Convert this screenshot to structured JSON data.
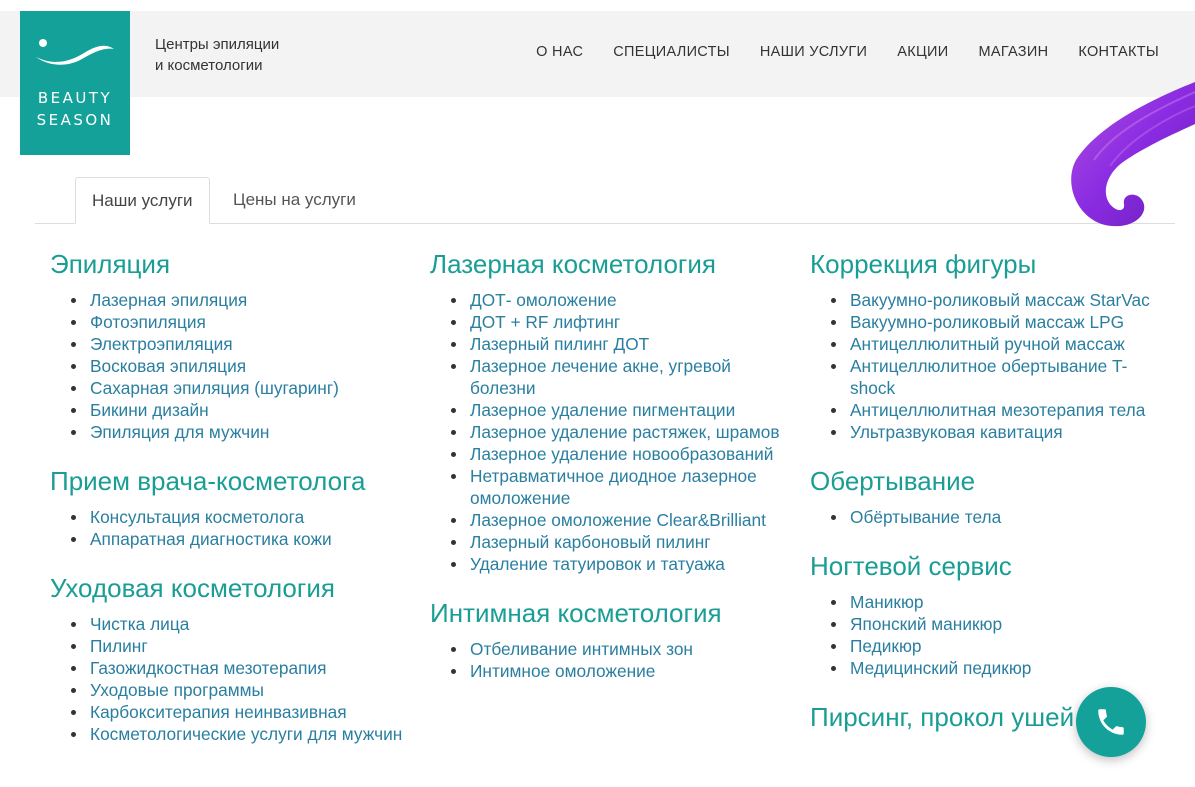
{
  "logo": {
    "line1": "BEAUTY",
    "line2": "SEASON"
  },
  "tagline": {
    "line1": "Центры эпиляции",
    "line2": "и косметологии"
  },
  "nav": [
    "О НАС",
    "СПЕЦИАЛИСТЫ",
    "НАШИ УСЛУГИ",
    "АКЦИИ",
    "МАГАЗИН",
    "КОНТАКТЫ"
  ],
  "tabs": {
    "active": "Наши услуги",
    "second": "Цены на услуги"
  },
  "columns": [
    [
      {
        "title": "Эпиляция",
        "items": [
          "Лазерная эпиляция",
          "Фотоэпиляция",
          "Электроэпиляция",
          "Восковая эпиляция",
          "Сахарная эпиляция (шугаринг)",
          "Бикини дизайн",
          "Эпиляция для мужчин"
        ]
      },
      {
        "title": "Прием врача-косметолога",
        "items": [
          "Консультация косметолога",
          "Аппаратная диагностика кожи"
        ]
      },
      {
        "title": "Уходовая косметология",
        "items": [
          "Чистка лица",
          "Пилинг",
          "Газожидкостная мезотерапия",
          "Уходовые программы",
          "Карбокситерапия неинвазивная",
          "Косметологические услуги для мужчин"
        ]
      }
    ],
    [
      {
        "title": "Лазерная косметология",
        "items": [
          "ДОТ- омоложение",
          "ДОТ + RF лифтинг",
          "Лазерный пилинг ДОТ",
          "Лазерное лечение акне, угревой болезни",
          "Лазерное удаление пигментации",
          "Лазерное удаление растяжек, шрамов",
          "Лазерное удаление новообразований",
          "Нетравматичное диодное лазерное омоложение",
          "Лазерное омоложение Clear&Brilliant",
          "Лазерный карбоновый пилинг",
          "Удаление татуировок и татуажа"
        ]
      },
      {
        "title": "Интимная косметология",
        "items": [
          "Отбеливание интимных зон",
          "Интимное омоложение"
        ]
      }
    ],
    [
      {
        "title": "Коррекция фигуры",
        "items": [
          "Вакуумно-роликовый массаж StarVac",
          "Вакуумно-роликовый массаж LPG",
          "Антицеллюлитный ручной массаж",
          "Антицеллюлитное обертывание T-shock",
          "Антицеллюлитная мезотерапия тела",
          "Ультразвуковая кавитация"
        ]
      },
      {
        "title": "Обертывание",
        "items": [
          "Обёртывание тела"
        ]
      },
      {
        "title": "Ногтевой сервис",
        "items": [
          "Маникюр",
          "Японский маникюр",
          "Педикюр",
          "Медицинский педикюр"
        ]
      },
      {
        "title": "Пирсинг, прокол ушей",
        "items": []
      }
    ]
  ],
  "icons": {
    "logo": "wave-logo-icon",
    "phone": "phone-icon",
    "decor": "purple-swirl-decoration"
  },
  "colors": {
    "brand": "#13a19a",
    "heading": "#1a9d95",
    "link": "#2a7fa0",
    "decor": "#8a2be2"
  }
}
